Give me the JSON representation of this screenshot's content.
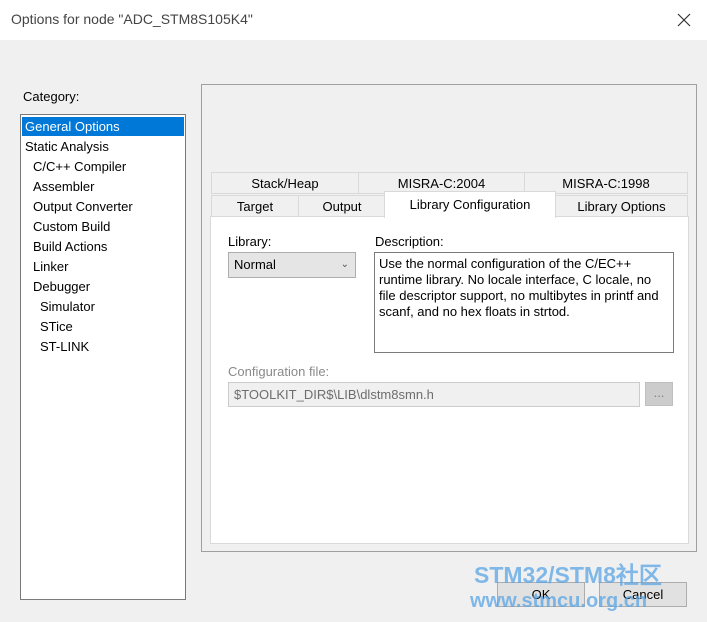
{
  "window": {
    "title": "Options for node \"ADC_STM8S105K4\""
  },
  "category": {
    "label": "Category:",
    "items": [
      "General Options",
      "Static Analysis",
      "C/C++ Compiler",
      "Assembler",
      "Output Converter",
      "Custom Build",
      "Build Actions",
      "Linker",
      "Debugger",
      "Simulator",
      "STice",
      "ST-LINK"
    ]
  },
  "tabs": {
    "row1": [
      "Stack/Heap",
      "MISRA-C:2004",
      "MISRA-C:1998"
    ],
    "row2": [
      "Target",
      "Output",
      "Library Configuration",
      "Library Options"
    ]
  },
  "library": {
    "label": "Library:",
    "value": "Normal",
    "description_label": "Description:",
    "description": "Use the normal configuration of the C/EC++ runtime library. No locale interface, C locale, no file descriptor support, no multibytes in printf and scanf, and no hex floats in strtod."
  },
  "config_file": {
    "label": "Configuration file:",
    "value": "$TOOLKIT_DIR$\\LIB\\dlstm8smn.h",
    "browse_label": "..."
  },
  "buttons": {
    "ok": "OK",
    "cancel": "Cancel"
  },
  "watermark": {
    "line1": "STM32/STM8社区",
    "line2": "www.stmcu.org.cn"
  }
}
